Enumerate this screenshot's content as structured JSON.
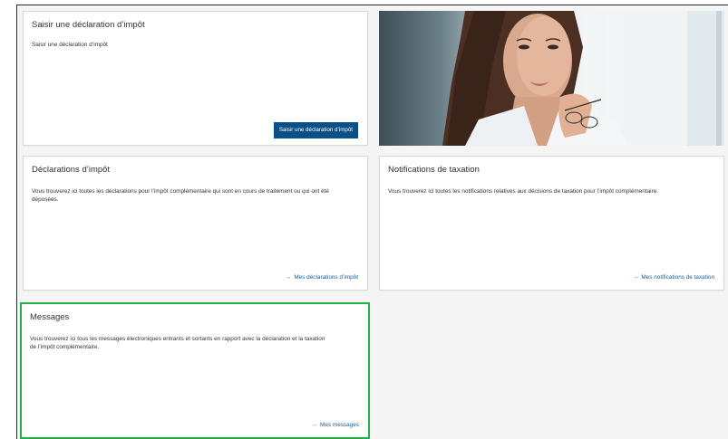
{
  "cards": {
    "submit": {
      "title": "Saisir une déclaration d’impôt",
      "desc": "Saisir une déclaration d’impôt",
      "button": "Saisir une déclaration d’impôt"
    },
    "declarations": {
      "title": "Déclarations d’impôt",
      "desc": "Vous trouverez ici toutes les déclarations pour l’impôt complémentaire qui sont en cours de traitement ou qui ont été déposées.",
      "link": "Mes déclarations d’impôt",
      "arrow": "→"
    },
    "notifications": {
      "title": "Notifications de taxation",
      "desc": "Vous trouverez ici toutes les notifications relatives aux décisions de taxation pour l’impôt complémentaire.",
      "link": "Mes notifications de taxation",
      "arrow": "→"
    },
    "messages": {
      "title": "Messages",
      "desc": "Vous trouverez ici tous les messages électroniques entrants et sortants en rapport avec la déclaration et la taxation de l’impôt complémentaire.",
      "link": "Mes messages",
      "arrow": "→"
    }
  },
  "colors": {
    "primary": "#0a4f86",
    "link": "#1a5a96",
    "highlight": "#22b04a"
  }
}
